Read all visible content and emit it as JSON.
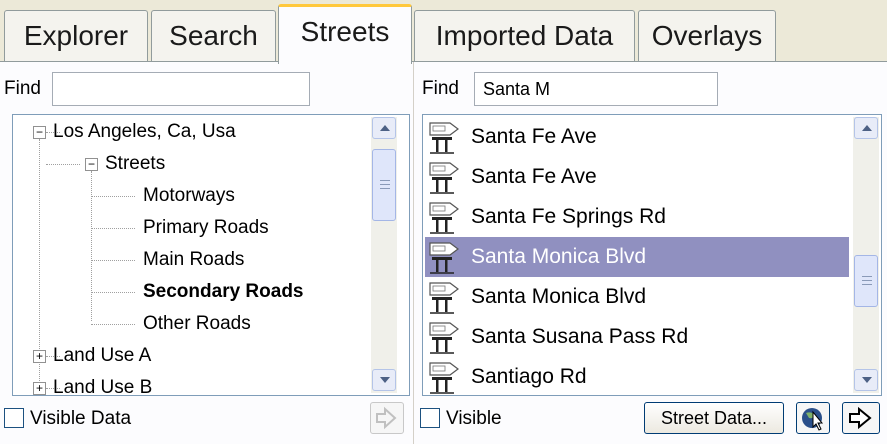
{
  "tabs": [
    {
      "label": "Explorer"
    },
    {
      "label": "Search"
    },
    {
      "label": "Streets",
      "active": true
    },
    {
      "label": "Imported Data"
    },
    {
      "label": "Overlays"
    }
  ],
  "left_panel": {
    "find_label": "Find",
    "find_value": "",
    "tree": {
      "root": "Los Angeles, Ca, Usa",
      "streets": "Streets",
      "items": [
        "Motorways",
        "Primary Roads",
        "Main Roads",
        "Secondary Roads",
        "Other Roads"
      ],
      "land_use_a": "Land Use A",
      "land_use_b": "Land Use B"
    },
    "visible_data_label": "Visible Data",
    "visible_data_checked": false
  },
  "right_panel": {
    "find_label": "Find",
    "find_value": "Santa M",
    "streets": [
      "Santa Fe Ave",
      "Santa Fe Ave",
      "Santa Fe Springs Rd",
      "Santa Monica Blvd",
      "Santa Monica Blvd",
      "Santa Susana Pass Rd",
      "Santiago Rd"
    ],
    "selected_index": 3,
    "visible_label": "Visible",
    "visible_checked": false,
    "street_data_button": "Street Data..."
  },
  "colors": {
    "selection": "#9090c0",
    "active_tab_accent": "#ffc83c"
  }
}
